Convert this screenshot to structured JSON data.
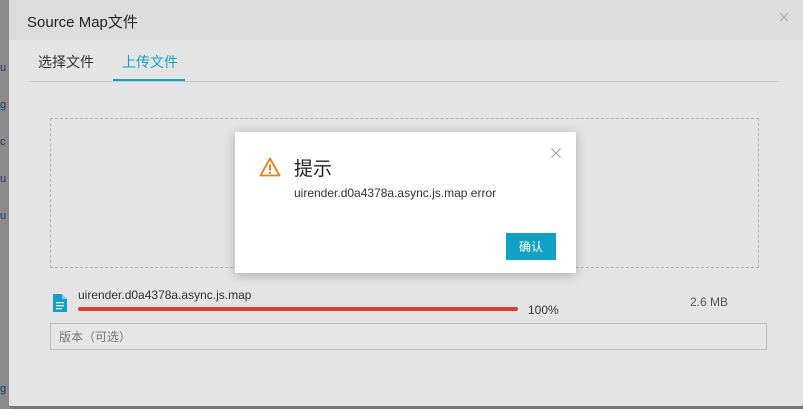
{
  "background_page": {
    "link_fragments": [
      "u",
      "g",
      "c",
      "u",
      "u",
      "g"
    ]
  },
  "dialog": {
    "title": "Source Map文件",
    "tabs": [
      {
        "label": "选择文件",
        "active": false
      },
      {
        "label": "上传文件",
        "active": true
      }
    ]
  },
  "upload": {
    "file_name": "uirender.d0a4378a.async.js.map",
    "progress_percent": 100,
    "progress_label": "100%",
    "file_size": "2.6 MB",
    "version_placeholder": "版本（可选）"
  },
  "alert": {
    "title": "提示",
    "message": "uirender.d0a4378a.async.js.map error",
    "confirm_label": "确认"
  },
  "colors": {
    "accent": "#12a1c5",
    "progress": "#d8402f",
    "warning": "#f07c1a"
  },
  "icons": {
    "dialog_close": "close-icon",
    "file": "file-icon",
    "alert_close": "close-icon",
    "alert": "warning-icon"
  }
}
